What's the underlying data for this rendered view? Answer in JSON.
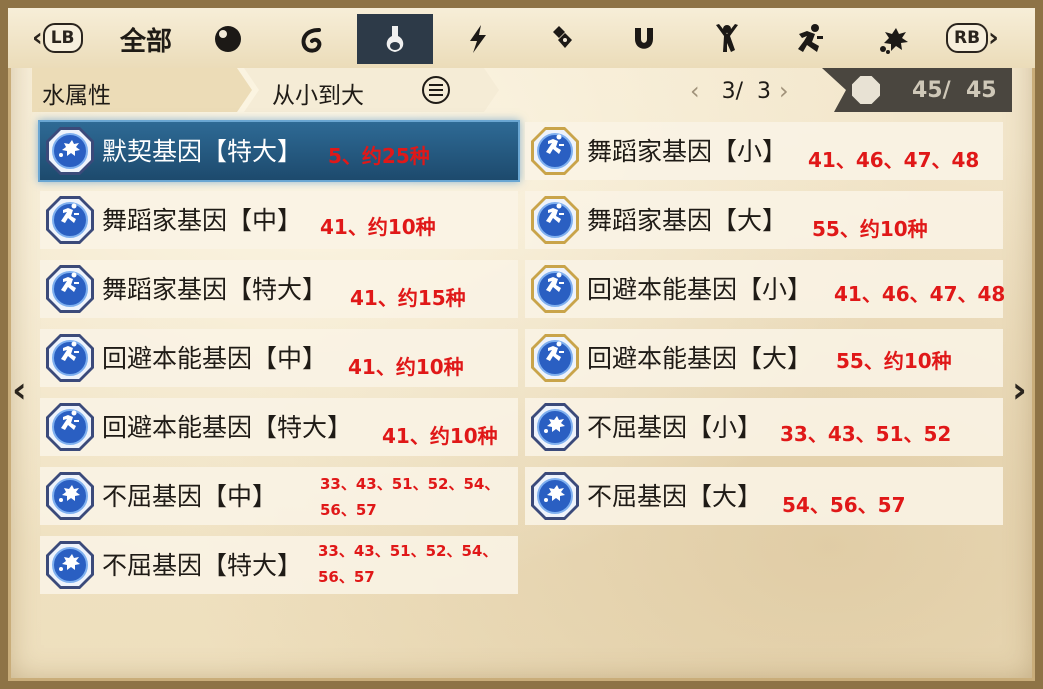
{
  "tabs": {
    "lb_label": "LB",
    "rb_label": "RB",
    "all_label": "全部",
    "icons": [
      "dark-orb-icon",
      "wind-swirl-icon",
      "water-drop-icon",
      "lightning-icon",
      "crystal-icon",
      "magnet-icon",
      "figure-icon",
      "running-man-icon",
      "burst-icon"
    ],
    "active_index": 2
  },
  "filter": {
    "element_label": "水属性",
    "sort_label": "从小到大"
  },
  "pager": {
    "current": "3/",
    "total": "3"
  },
  "count": {
    "value": "45/  45"
  },
  "left_items": [
    {
      "name": "默契基因【特大】",
      "note": "5、约25种",
      "icon": "burst-icon",
      "selected": true
    },
    {
      "name": "舞蹈家基因【中】",
      "note": "41、约10种",
      "icon": "running-man-icon"
    },
    {
      "name": "舞蹈家基因【特大】",
      "note": "41、约15种",
      "icon": "running-man-icon"
    },
    {
      "name": "回避本能基因【中】",
      "note": "41、约10种",
      "icon": "running-man-icon"
    },
    {
      "name": "回避本能基因【特大】",
      "note": "41、约10种",
      "icon": "running-man-icon"
    },
    {
      "name": "不屈基因【中】",
      "note": "33、43、51、52、54、56、57",
      "icon": "burst-icon"
    },
    {
      "name": "不屈基因【特大】",
      "note": "33、43、51、52、54、56、57",
      "icon": "burst-icon"
    }
  ],
  "right_items": [
    {
      "name": "舞蹈家基因【小】",
      "note": "41、46、47、48",
      "icon": "running-man-icon"
    },
    {
      "name": "舞蹈家基因【大】",
      "note": "55、约10种",
      "icon": "running-man-icon"
    },
    {
      "name": "回避本能基因【小】",
      "note": "41、46、47、48",
      "icon": "running-man-icon"
    },
    {
      "name": "回避本能基因【大】",
      "note": "55、约10种",
      "icon": "running-man-icon"
    },
    {
      "name": "不屈基因【小】",
      "note": "33、43、51、52",
      "icon": "burst-icon"
    },
    {
      "name": "不屈基因【大】",
      "note": "54、56、57",
      "icon": "burst-icon"
    }
  ],
  "colors": {
    "note_red": "#e01818",
    "selected_blue": "#2e6a95",
    "active_tab": "#2d3a48"
  }
}
